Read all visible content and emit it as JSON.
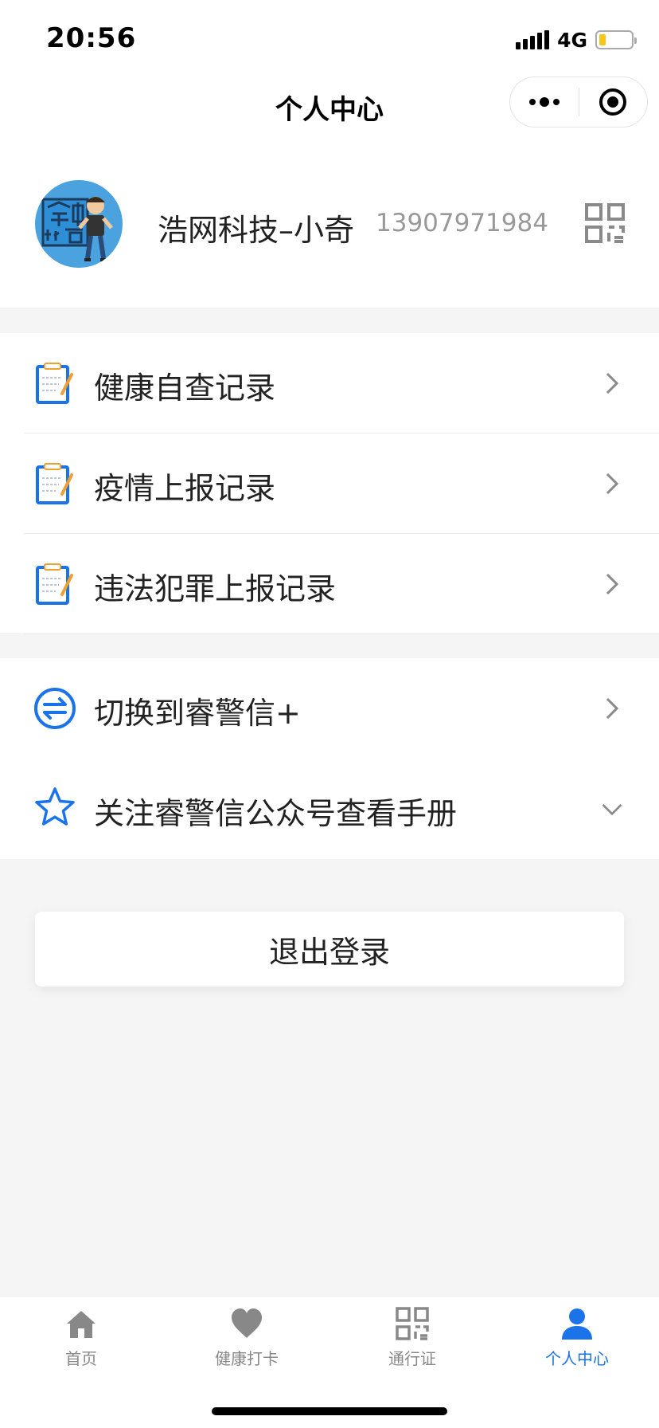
{
  "status": {
    "time": "20:56",
    "network": "4G"
  },
  "nav": {
    "title": "个人中心"
  },
  "profile": {
    "name": "浩网科技–小奇",
    "phone": "13907971984",
    "avatar_text": "金中小奇"
  },
  "menu_records": [
    {
      "label": "健康自查记录",
      "icon": "clipboard-icon"
    },
    {
      "label": "疫情上报记录",
      "icon": "clipboard-icon"
    },
    {
      "label": "违法犯罪上报记录",
      "icon": "clipboard-icon"
    }
  ],
  "menu_other": [
    {
      "label": "切换到睿警信+",
      "icon": "switch-icon"
    },
    {
      "label": "关注睿警信公众号查看手册",
      "icon": "star-icon"
    }
  ],
  "logout": {
    "label": "退出登录"
  },
  "tabs": [
    {
      "label": "首页",
      "icon": "home-icon",
      "active": false
    },
    {
      "label": "健康打卡",
      "icon": "heart-icon",
      "active": false
    },
    {
      "label": "通行证",
      "icon": "qr-code-icon",
      "active": false
    },
    {
      "label": "个人中心",
      "icon": "person-icon",
      "active": true
    }
  ],
  "colors": {
    "accent": "#1a73e8",
    "background": "#f5f5f5",
    "inactive_tab": "#888888"
  }
}
